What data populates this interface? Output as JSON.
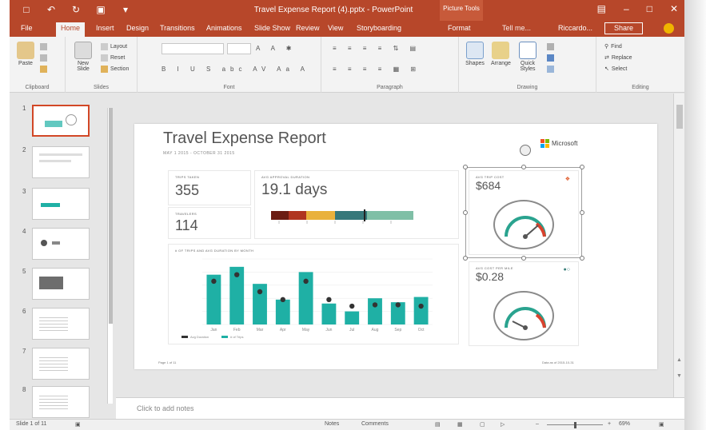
{
  "app": {
    "title": "Travel Expense Report (4).pptx - PowerPoint",
    "context_tab_title": "Picture Tools",
    "qat": [
      "save-icon",
      "undo-icon",
      "redo-icon",
      "start-icon",
      "customize-icon"
    ],
    "user": "Riccardo...",
    "share": "Share",
    "tell_me": "Tell me..."
  },
  "tabs": [
    "File",
    "Home",
    "Insert",
    "Design",
    "Transitions",
    "Animations",
    "Slide Show",
    "Review",
    "View",
    "Storyboarding",
    "Format"
  ],
  "ribbon": {
    "groups": [
      "Clipboard",
      "Slides",
      "Font",
      "Paragraph",
      "Drawing",
      "Editing"
    ],
    "paste": "Paste",
    "new_slide": "New Slide",
    "layout": "Layout",
    "reset": "Reset",
    "section": "Section",
    "shapes": "Shapes",
    "arrange": "Arrange",
    "quick_styles": "Quick Styles",
    "find": "Find",
    "replace": "Replace",
    "select": "Select"
  },
  "thumbnails": [
    "1",
    "2",
    "3",
    "4",
    "5",
    "6",
    "7",
    "8"
  ],
  "slide": {
    "title": "Travel Expense Report",
    "subtitle": "MAY 1 2015 - OCTOBER 31 2015",
    "brand": "Microsoft",
    "kpis": {
      "trips_label": "TRIPS TAKEN",
      "trips_value": "355",
      "approval_label": "AVG APPROVAL DURATION",
      "approval_value": "19.1 days",
      "travelers_label": "TRAVELERS",
      "travelers_value": "114",
      "cost_label": "AVG TRIP COST",
      "cost_value": "$684",
      "mile_label": "AVG COST PER MILE",
      "mile_value": "$0.28"
    },
    "footer_left": "Page 1 of 11",
    "footer_right": "Data as of 2015-10-31"
  },
  "chart_data": {
    "type": "bar",
    "title": "# OF TRIPS AND AVG DURATION BY MONTH",
    "categories": [
      "Jan",
      "Feb",
      "Mar",
      "Apr",
      "May",
      "Jun",
      "Jul",
      "Aug",
      "Sep",
      "Oct"
    ],
    "series": [
      {
        "name": "# of Trips",
        "values": [
          38,
          44,
          31,
          19,
          40,
          16,
          10,
          20,
          17,
          21
        ]
      },
      {
        "name": "Avg Duration",
        "values": [
          33,
          38,
          25,
          19,
          33,
          19,
          14,
          15,
          15,
          14
        ]
      }
    ],
    "ylim": [
      0,
      50
    ],
    "colors": {
      "bars": "#1fb0a5",
      "markers": "#333333"
    }
  },
  "kpi_bar_colors": [
    "#6b1d13",
    "#b03520",
    "#e9b13b",
    "#36787a",
    "#7fbfa6"
  ],
  "notes_placeholder": "Click to add notes",
  "status": {
    "slide": "Slide 1 of 11",
    "notes": "Notes",
    "comments": "Comments",
    "zoom": "69%"
  }
}
